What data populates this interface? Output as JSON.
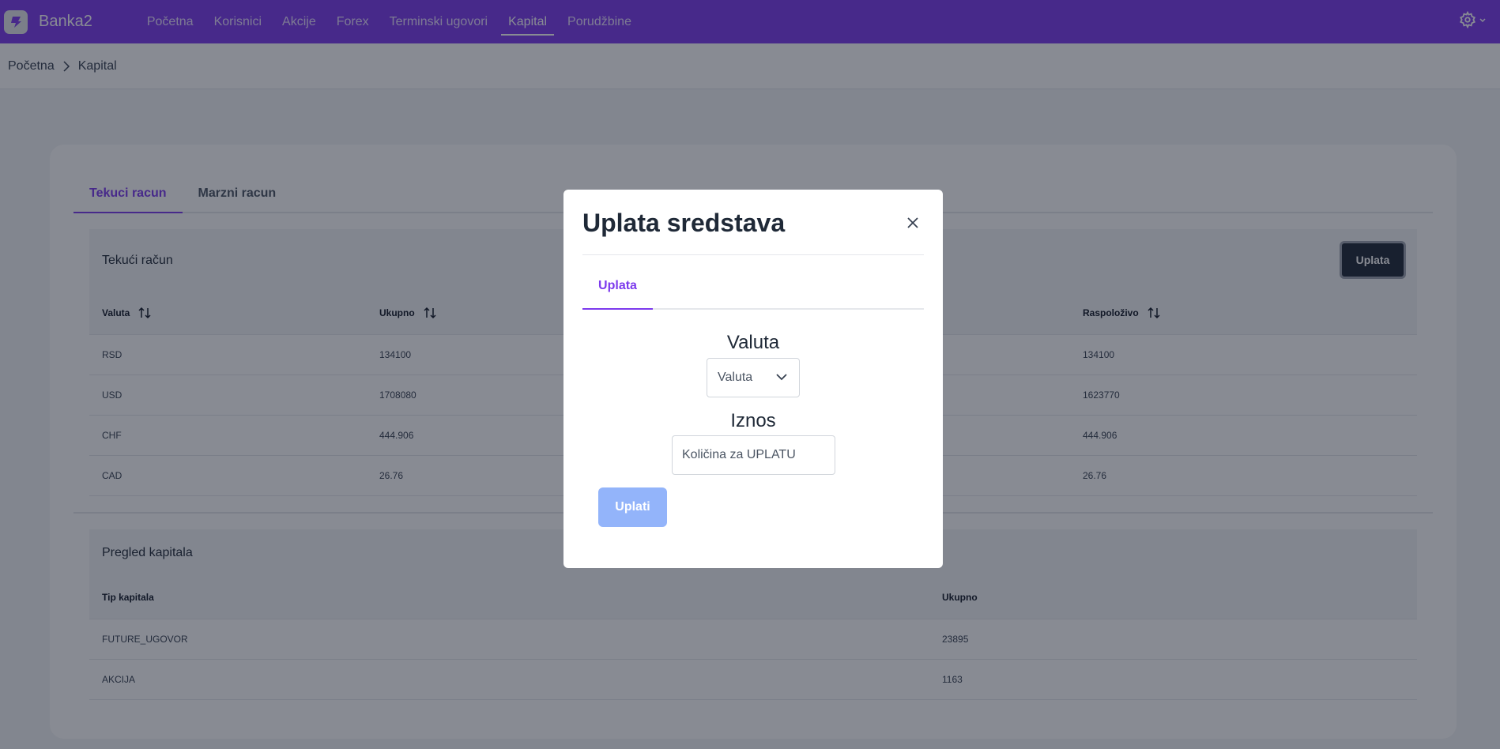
{
  "navbar": {
    "brand": "Banka2",
    "links": [
      {
        "label": "Početna",
        "active": false
      },
      {
        "label": "Korisnici",
        "active": false
      },
      {
        "label": "Akcije",
        "active": false
      },
      {
        "label": "Forex",
        "active": false
      },
      {
        "label": "Terminski ugovori",
        "active": false
      },
      {
        "label": "Kapital",
        "active": true
      },
      {
        "label": "Porudžbine",
        "active": false
      }
    ],
    "settings_icon": "gear-icon"
  },
  "breadcrumb": {
    "items": [
      "Početna",
      "Kapital"
    ]
  },
  "card": {
    "tabs": [
      {
        "label": "Tekuci racun",
        "active": true
      },
      {
        "label": "Marzni racun",
        "active": false
      }
    ],
    "tekuci": {
      "title": "Tekući račun",
      "uplata_button": "Uplata",
      "columns": [
        "Valuta",
        "Ukupno",
        "",
        "Raspoloživo"
      ],
      "rows": [
        {
          "valuta": "RSD",
          "ukupno": "134100",
          "raspolozivo": "134100"
        },
        {
          "valuta": "USD",
          "ukupno": "1708080",
          "raspolozivo": "1623770"
        },
        {
          "valuta": "CHF",
          "ukupno": "444.906",
          "raspolozivo": "444.906"
        },
        {
          "valuta": "CAD",
          "ukupno": "26.76",
          "raspolozivo": "26.76"
        }
      ]
    },
    "pregled": {
      "title": "Pregled kapitala",
      "columns": [
        "Tip kapitala",
        "Ukupno"
      ],
      "rows": [
        {
          "tip": "FUTURE_UGOVOR",
          "ukupno": "23895"
        },
        {
          "tip": "AKCIJA",
          "ukupno": "1163"
        }
      ]
    }
  },
  "modal": {
    "title": "Uplata sredstava",
    "tab": "Uplata",
    "valuta_label": "Valuta",
    "valuta_select_value": "Valuta",
    "iznos_label": "Iznos",
    "iznos_placeholder": "Količina za UPLATU",
    "submit": "Uplati"
  },
  "colors": {
    "primary": "#7c3aed",
    "submit_disabled": "#93b4fa",
    "dark_button": "#1f2937"
  }
}
